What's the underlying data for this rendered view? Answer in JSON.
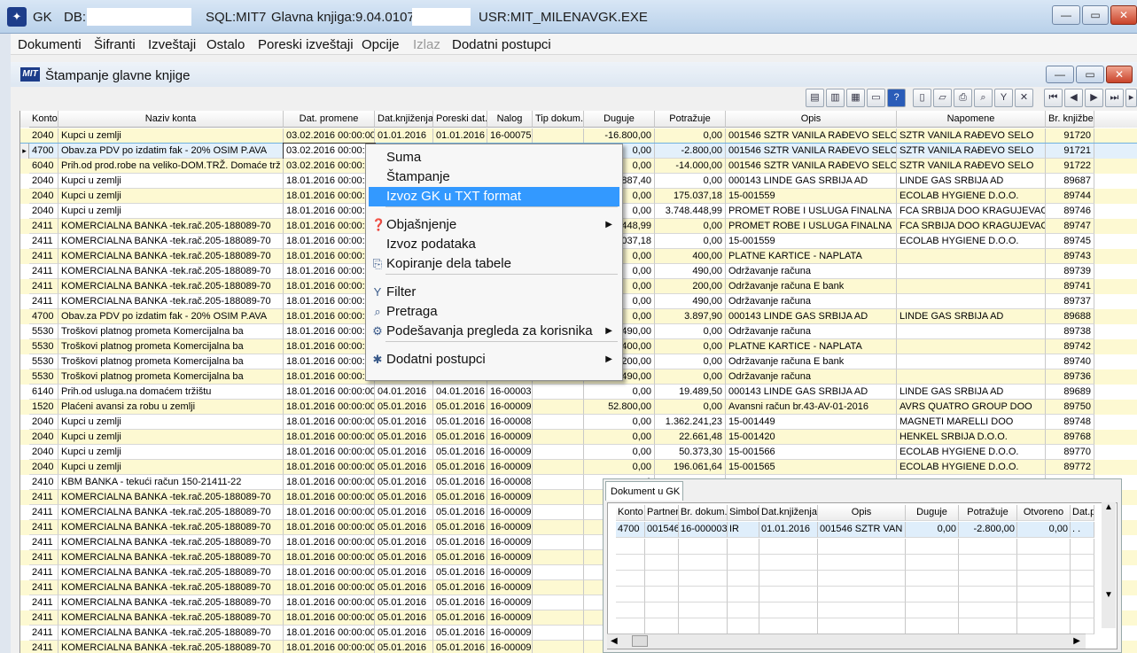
{
  "titlebar": {
    "app": "GK",
    "db_label": "DB:",
    "sql": "SQL:MIT7",
    "version": "Glavna knjiga:9.04.0107",
    "user": "USR:MIT_MILENA",
    "exe": "VGK.EXE",
    "minimize": "—",
    "maximize": "▭",
    "close": "✕"
  },
  "menu": [
    "Dokumenti",
    "Šifranti",
    "Izveštaji",
    "Ostalo",
    "Poreski izveštaji",
    "Opcije",
    "Izlaz",
    "Dodatni postupci"
  ],
  "subwindow": {
    "logo": "MIT",
    "title": "Štampanje glavne knjige"
  },
  "grid": {
    "headers": [
      "Konto",
      "Naziv konta",
      "Dat. promene",
      "Dat.knjiženja",
      "Poreski dat.",
      "Nalog",
      "Tip dokum.",
      "Duguje",
      "Potražuje",
      "Opis",
      "Napomene",
      "Br. knjižbe"
    ],
    "rows": [
      [
        "2040",
        "Kupci u zemlji",
        "03.02.2016 00:00:00",
        "01.01.2016",
        "01.01.2016",
        "16-00075",
        "",
        "-16.800,00",
        "0,00",
        "001546 SZTR VANILA RAĐEVO SELO",
        "SZTR VANILA RAĐEVO SELO",
        "91720"
      ],
      [
        "4700",
        "Obav.za PDV po izdatim fak - 20%     OSIM P.AVA",
        "03.02.2016 00:00:",
        "",
        "",
        "",
        "",
        "0,00",
        "-2.800,00",
        "001546 SZTR VANILA RAĐEVO SELO",
        "SZTR VANILA RAĐEVO SELO",
        "91721"
      ],
      [
        "6040",
        "Prih.od prod.robe na veliko-DOM.TRŽ.   Domaće trž",
        "03.02.2016 00:00:0",
        "",
        "",
        "",
        "",
        "0,00",
        "-14.000,00",
        "001546 SZTR VANILA RAĐEVO SELO",
        "SZTR VANILA RAĐEVO SELO",
        "91722"
      ],
      [
        "2040",
        "Kupci u zemlji",
        "18.01.2016 00:00:0",
        "",
        "",
        "",
        "",
        "887,40",
        "0,00",
        "000143 LINDE GAS SRBIJA AD",
        "LINDE GAS SRBIJA AD",
        "89687"
      ],
      [
        "2040",
        "Kupci u zemlji",
        "18.01.2016 00:00:0",
        "",
        "",
        "",
        "",
        "0,00",
        "175.037,18",
        "15-001559",
        "ECOLAB HYGIENE D.O.O.",
        "89744"
      ],
      [
        "2040",
        "Kupci u zemlji",
        "18.01.2016 00:00:0",
        "",
        "",
        "",
        "",
        "0,00",
        "3.748.448,99",
        "PROMET ROBE I USLUGA  FINALNA",
        "FCA  SRBIJA DOO KRAGUJEVAC",
        "89746"
      ],
      [
        "2411",
        "KOMERCIALNA BANKA -tek.rač.205-188089-70",
        "18.01.2016 00:00:0",
        "",
        "",
        "",
        "",
        "448,99",
        "0,00",
        "PROMET ROBE I USLUGA  FINALNA",
        "FCA  SRBIJA DOO KRAGUJEVAC",
        "89747"
      ],
      [
        "2411",
        "KOMERCIALNA BANKA -tek.rač.205-188089-70",
        "18.01.2016 00:00:0",
        "",
        "",
        "",
        "",
        "037,18",
        "0,00",
        "15-001559",
        "ECOLAB HYGIENE D.O.O.",
        "89745"
      ],
      [
        "2411",
        "KOMERCIALNA BANKA -tek.rač.205-188089-70",
        "18.01.2016 00:00:0",
        "",
        "",
        "",
        "",
        "0,00",
        "400,00",
        "PLATNE KARTICE - NAPLATA",
        "",
        "89743"
      ],
      [
        "2411",
        "KOMERCIALNA BANKA -tek.rač.205-188089-70",
        "18.01.2016 00:00:0",
        "",
        "",
        "",
        "",
        "0,00",
        "490,00",
        "Održavanje računa",
        "",
        "89739"
      ],
      [
        "2411",
        "KOMERCIALNA BANKA -tek.rač.205-188089-70",
        "18.01.2016 00:00:0",
        "",
        "",
        "",
        "",
        "0,00",
        "200,00",
        "Održavanje računa  E bank",
        "",
        "89741"
      ],
      [
        "2411",
        "KOMERCIALNA BANKA -tek.rač.205-188089-70",
        "18.01.2016 00:00:0",
        "",
        "",
        "",
        "",
        "0,00",
        "490,00",
        "Održavanje računa",
        "",
        "89737"
      ],
      [
        "4700",
        "Obav.za PDV po izdatim fak - 20%     OSIM P.AVA",
        "18.01.2016 00:00:0",
        "",
        "",
        "",
        "",
        "0,00",
        "3.897,90",
        "000143 LINDE GAS SRBIJA AD",
        "LINDE GAS SRBIJA AD",
        "89688"
      ],
      [
        "5530",
        "Troškovi platnog prometa Komercijalna ba",
        "18.01.2016 00:00:0",
        "",
        "",
        "",
        "",
        "490,00",
        "0,00",
        "Održavanje računa",
        "",
        "89738"
      ],
      [
        "5530",
        "Troškovi platnog prometa Komercijalna ba",
        "18.01.2016 00:00:0",
        "",
        "",
        "",
        "",
        "400,00",
        "0,00",
        "PLATNE KARTICE - NAPLATA",
        "",
        "89742"
      ],
      [
        "5530",
        "Troškovi platnog prometa Komercijalna ba",
        "18.01.2016 00:00:0",
        "",
        "",
        "",
        "",
        "200,00",
        "0,00",
        "Održavanje računa  E bank",
        "",
        "89740"
      ],
      [
        "5530",
        "Troškovi platnog prometa Komercijalna ba",
        "18.01.2016 00:00:0",
        "",
        "",
        "",
        "",
        "490,00",
        "0,00",
        "Održavanje računa",
        "",
        "89736"
      ],
      [
        "6140",
        "Prih.od usluga.na domaćem tržištu",
        "18.01.2016 00:00:00",
        "04.01.2016",
        "04.01.2016",
        "16-00003",
        "",
        "0,00",
        "19.489,50",
        "000143 LINDE GAS SRBIJA AD",
        "LINDE GAS SRBIJA AD",
        "89689"
      ],
      [
        "1520",
        "Plaćeni avansi za robu u zemlji",
        "18.01.2016 00:00:00",
        "05.01.2016",
        "05.01.2016",
        "16-00009",
        "",
        "52.800,00",
        "0,00",
        "Avansni račun br.43-AV-01-2016",
        "AVRS QUATRO GROUP DOO",
        "89750"
      ],
      [
        "2040",
        "Kupci u zemlji",
        "18.01.2016 00:00:00",
        "05.01.2016",
        "05.01.2016",
        "16-00008",
        "",
        "0,00",
        "1.362.241,23",
        "15-001449",
        "MAGNETI MARELLI DOO",
        "89748"
      ],
      [
        "2040",
        "Kupci u zemlji",
        "18.01.2016 00:00:00",
        "05.01.2016",
        "05.01.2016",
        "16-00009",
        "",
        "0,00",
        "22.661,48",
        "15-001420",
        "HENKEL SRBIJA D.O.O.",
        "89768"
      ],
      [
        "2040",
        "Kupci u zemlji",
        "18.01.2016 00:00:00",
        "05.01.2016",
        "05.01.2016",
        "16-00009",
        "",
        "0,00",
        "50.373,30",
        "15-001566",
        "ECOLAB HYGIENE D.O.O.",
        "89770"
      ],
      [
        "2040",
        "Kupci u zemlji",
        "18.01.2016 00:00:00",
        "05.01.2016",
        "05.01.2016",
        "16-00009",
        "",
        "0,00",
        "196.061,64",
        "15-001565",
        "ECOLAB HYGIENE D.O.O.",
        "89772"
      ],
      [
        "2410",
        "KBM BANKA - tekući račun 150-21411-22",
        "18.01.2016 00:00:00",
        "05.01.2016",
        "05.01.2016",
        "16-00008",
        "",
        "1",
        "",
        "",
        "",
        ""
      ],
      [
        "2411",
        "KOMERCIALNA BANKA -tek.rač.205-188089-70",
        "18.01.2016 00:00:00",
        "05.01.2016",
        "05.01.2016",
        "16-00009",
        "",
        "",
        "",
        "",
        "",
        ""
      ],
      [
        "2411",
        "KOMERCIALNA BANKA -tek.rač.205-188089-70",
        "18.01.2016 00:00:00",
        "05.01.2016",
        "05.01.2016",
        "16-00009",
        "",
        "",
        "",
        "",
        "",
        ""
      ],
      [
        "2411",
        "KOMERCIALNA BANKA -tek.rač.205-188089-70",
        "18.01.2016 00:00:00",
        "05.01.2016",
        "05.01.2016",
        "16-00009",
        "",
        "",
        "",
        "",
        "",
        ""
      ],
      [
        "2411",
        "KOMERCIALNA BANKA -tek.rač.205-188089-70",
        "18.01.2016 00:00:00",
        "05.01.2016",
        "05.01.2016",
        "16-00009",
        "",
        "",
        "",
        "",
        "",
        ""
      ],
      [
        "2411",
        "KOMERCIALNA BANKA -tek.rač.205-188089-70",
        "18.01.2016 00:00:00",
        "05.01.2016",
        "05.01.2016",
        "16-00009",
        "",
        "",
        "",
        "",
        "",
        ""
      ],
      [
        "2411",
        "KOMERCIALNA BANKA -tek.rač.205-188089-70",
        "18.01.2016 00:00:00",
        "05.01.2016",
        "05.01.2016",
        "16-00009",
        "",
        "",
        "",
        "",
        "",
        ""
      ],
      [
        "2411",
        "KOMERCIALNA BANKA -tek.rač.205-188089-70",
        "18.01.2016 00:00:00",
        "05.01.2016",
        "05.01.2016",
        "16-00009",
        "",
        "",
        "",
        "",
        "",
        ""
      ],
      [
        "2411",
        "KOMERCIALNA BANKA -tek.rač.205-188089-70",
        "18.01.2016 00:00:00",
        "05.01.2016",
        "05.01.2016",
        "16-00009",
        "",
        "",
        "",
        "",
        "",
        ""
      ],
      [
        "2411",
        "KOMERCIALNA BANKA -tek.rač.205-188089-70",
        "18.01.2016 00:00:00",
        "05.01.2016",
        "05.01.2016",
        "16-00009",
        "",
        "",
        "",
        "",
        "",
        ""
      ],
      [
        "2411",
        "KOMERCIALNA BANKA -tek.rač.205-188089-70",
        "18.01.2016 00:00:00",
        "05.01.2016",
        "05.01.2016",
        "16-00009",
        "",
        "",
        "",
        "",
        "",
        ""
      ],
      [
        "2411",
        "KOMERCIALNA BANKA -tek.rač.205-188089-70",
        "18.01.2016 00:00:00",
        "05.01.2016",
        "05.01.2016",
        "16-00009",
        "",
        "",
        "",
        "",
        "",
        ""
      ]
    ]
  },
  "context_menu": {
    "items": [
      {
        "label": "Suma",
        "icon": "",
        "sub": false
      },
      {
        "label": "Štampanje",
        "icon": "",
        "sub": false
      },
      {
        "label": "Izvoz GK u TXT format",
        "icon": "",
        "sub": false,
        "highlight": true
      },
      {
        "label": "Objašnjenje",
        "icon": "help-doc-icon",
        "sub": true
      },
      {
        "label": "Izvoz podataka",
        "icon": "",
        "sub": false
      },
      {
        "label": "Kopiranje dela tabele",
        "icon": "copy-icon",
        "sub": false
      },
      {
        "label": "Filter",
        "icon": "filter-icon",
        "sub": false
      },
      {
        "label": "Pretraga",
        "icon": "search-icon",
        "sub": false
      },
      {
        "label": "Podešavanja pregleda za korisnika",
        "icon": "settings-icon",
        "sub": true
      },
      {
        "label": "Dodatni postupci",
        "icon": "tools-icon",
        "sub": true
      }
    ]
  },
  "dock": {
    "tab": "Dokument u GK",
    "headers": [
      "Konto",
      "Partner",
      "Br. dokum.",
      "Simbol",
      "Dat.knjiženja",
      "Opis",
      "Duguje",
      "Potražuje",
      "Otvoreno",
      "Dat.p"
    ],
    "row": [
      "4700",
      "001546",
      "16-000003",
      "IR",
      "01.01.2016",
      "001546 SZTR VAN",
      "0,00",
      "-2.800,00",
      "0,00",
      ". ."
    ]
  }
}
